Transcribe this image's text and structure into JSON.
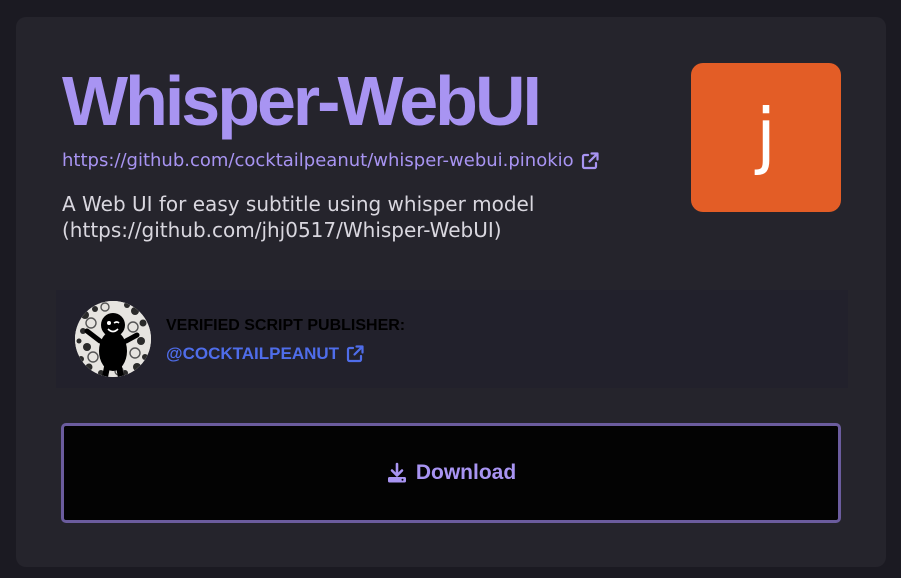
{
  "app": {
    "title": "Whisper-WebUI",
    "repo_url": "https://github.com/cocktailpeanut/whisper-webui.pinokio",
    "description": "A Web UI for easy subtitle using whisper model (https://github.com/jhj0517/Whisper-WebUI)",
    "icon_letter": "j"
  },
  "publisher": {
    "label": "VERIFIED SCRIPT PUBLISHER:",
    "handle": "@COCKTAILPEANUT"
  },
  "actions": {
    "download_label": "Download"
  },
  "icons": {
    "external_link": "external-link-icon",
    "download": "download-icon"
  },
  "colors": {
    "accent": "#a894f2",
    "app_icon_bg": "#e35d26",
    "publisher_link": "#4f6dea",
    "card_bg": "#25242c",
    "button_border": "#6b5c9e"
  }
}
